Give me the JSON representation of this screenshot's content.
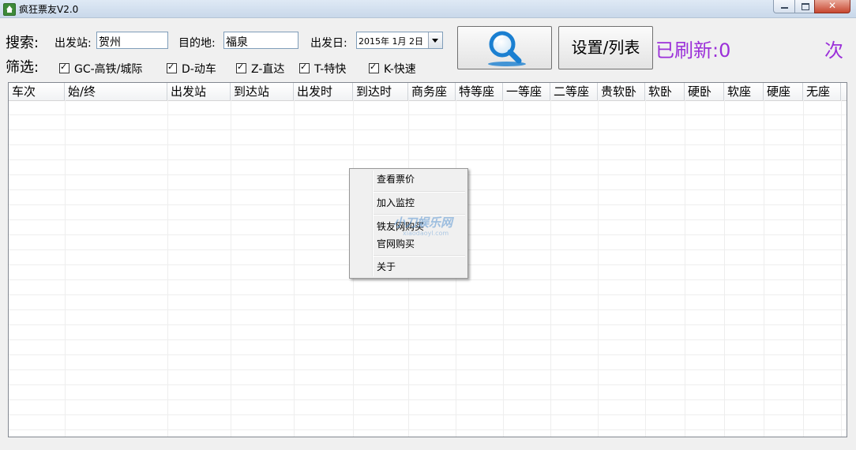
{
  "window": {
    "title": "疯狂票友V2.0"
  },
  "search": {
    "label": "搜索:",
    "from_label": "出发站:",
    "from_value": "贺州",
    "to_label": "目的地:",
    "to_value": "福泉",
    "date_label": "出发日:",
    "date_value": "2015年 1月 2日",
    "settings_label": "设置/列表",
    "refresh_label": "已刷新:0",
    "refresh_suffix": "次"
  },
  "filters": {
    "label": "筛选:",
    "items": [
      {
        "label": "GC-高铁/城际",
        "checked": true
      },
      {
        "label": "D-动车",
        "checked": true
      },
      {
        "label": "Z-直达",
        "checked": true
      },
      {
        "label": "T-特快",
        "checked": true
      },
      {
        "label": "K-快速",
        "checked": true
      }
    ]
  },
  "table": {
    "columns": [
      "车次",
      "始/终",
      "出发站",
      "到达站",
      "出发时",
      "到达时",
      "商务座",
      "特等座",
      "一等座",
      "二等座",
      "贵软卧",
      "软卧",
      "硬卧",
      "软座",
      "硬座",
      "无座"
    ],
    "rows": []
  },
  "context_menu": {
    "items": [
      "查看票价",
      "加入监控",
      "铁友网购买",
      "官网购买",
      "关于"
    ]
  },
  "watermark": {
    "text": "小刀娱乐网",
    "sub": "xiaodaoyl.com"
  },
  "icons": {
    "search": "magnifier-icon",
    "app": "home-icon"
  },
  "colors": {
    "refresh": "#9b30d9",
    "search_icon": "#1a7fd1"
  }
}
